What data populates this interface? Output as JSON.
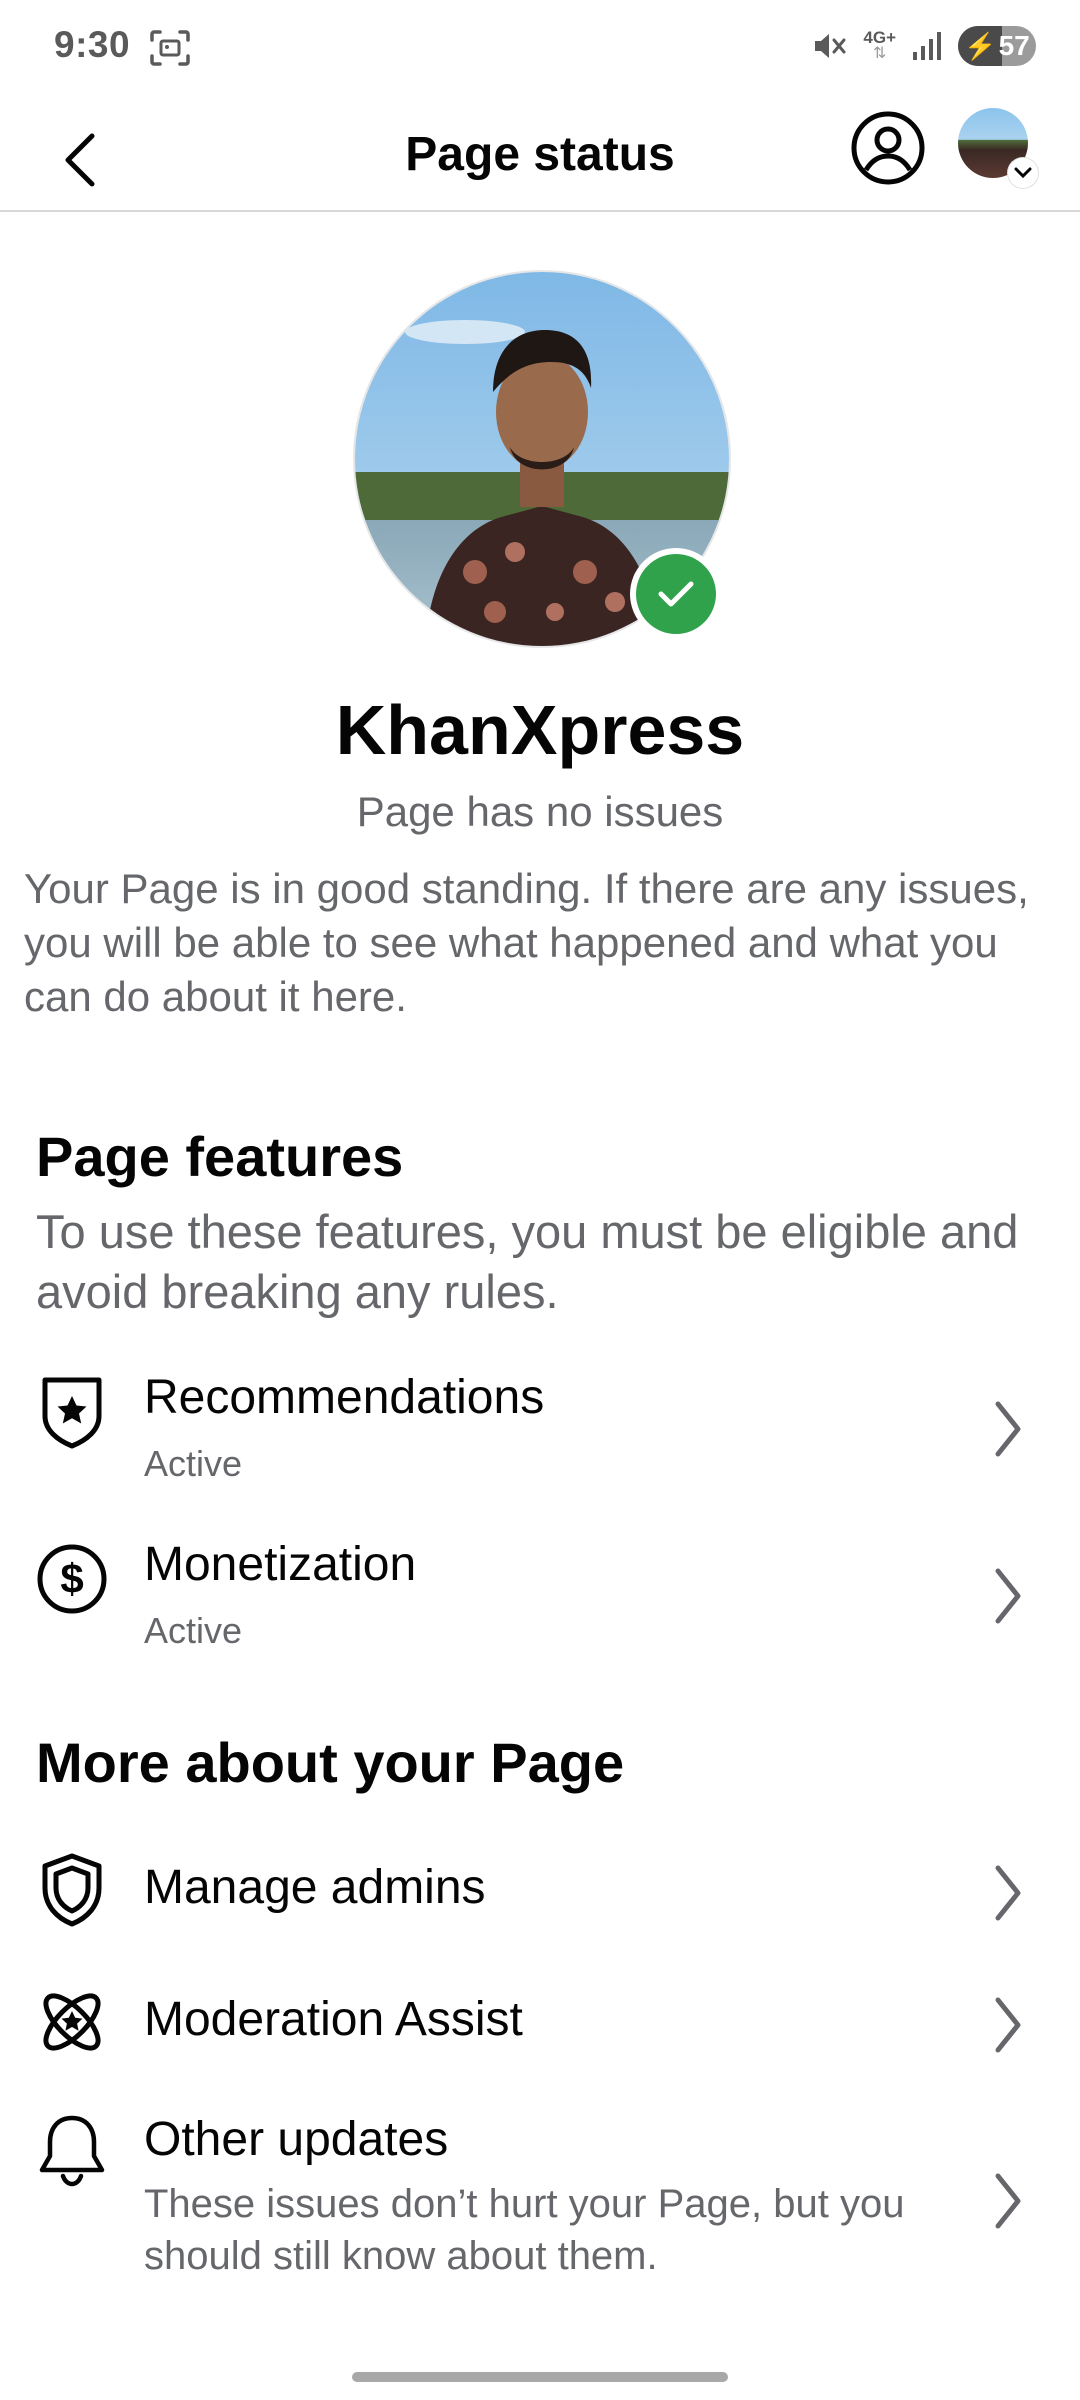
{
  "status_bar": {
    "time": "9:30",
    "network": "4G+",
    "battery": "57",
    "battery_level": 0.57
  },
  "header": {
    "title": "Page status"
  },
  "profile": {
    "name": "KhanXpress",
    "status": "Page has no issues",
    "description": "Your Page is in good standing. If there are any issues, you will be able to see what happened and what you can do about it here."
  },
  "features": {
    "title": "Page features",
    "subtitle": "To use these features, you must be eligible and avoid breaking any rules.",
    "items": [
      {
        "label": "Recommendations",
        "status": "Active",
        "icon": "shield-star-icon"
      },
      {
        "label": "Monetization",
        "status": "Active",
        "icon": "dollar-circle-icon"
      }
    ]
  },
  "more": {
    "title": "More about your Page",
    "items": [
      {
        "label": "Manage admins",
        "icon": "shield-icon"
      },
      {
        "label": "Moderation Assist",
        "icon": "atom-star-icon"
      },
      {
        "label": "Other updates",
        "description": "These issues don’t hurt your Page, but you should still know about them.",
        "icon": "bell-icon"
      }
    ]
  },
  "colors": {
    "accent_green": "#31a24c",
    "secondary_text": "#65676b",
    "primary_text": "#050505"
  }
}
